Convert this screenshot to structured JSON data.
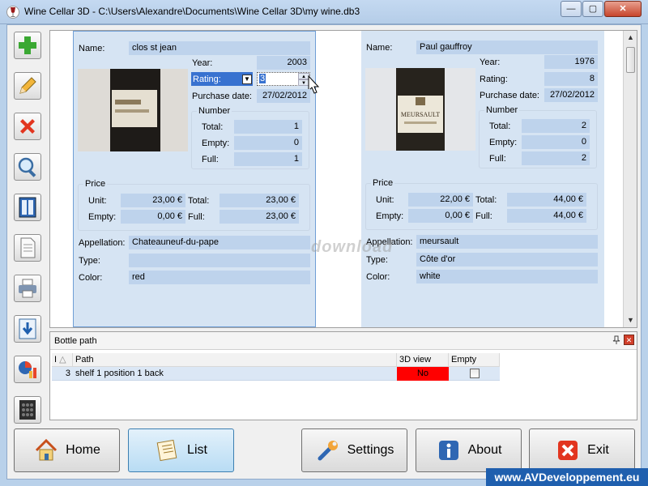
{
  "window": {
    "title": "Wine Cellar 3D - C:\\Users\\Alexandre\\Documents\\Wine Cellar 3D\\my wine.db3",
    "minimize": "—",
    "maximize": "▢",
    "close": "✕"
  },
  "toolbar": {
    "icons": [
      "add-icon",
      "edit-icon",
      "delete-icon",
      "search-icon",
      "cellar-icon",
      "document-icon",
      "print-icon",
      "export-icon",
      "statistics-icon",
      "wine-rack-icon"
    ]
  },
  "labels": {
    "name": "Name:",
    "year": "Year:",
    "rating": "Rating:",
    "purchase_date": "Purchase date:",
    "number": "Number",
    "total": "Total:",
    "empty": "Empty:",
    "full": "Full:",
    "price": "Price",
    "unit": "Unit:",
    "appellation": "Appellation:",
    "type": "Type:",
    "color": "Color:"
  },
  "wines": [
    {
      "name": "clos st jean",
      "year": "2003",
      "rating": "3",
      "purchase_date": "27/02/2012",
      "number_total": "1",
      "number_empty": "0",
      "number_full": "1",
      "price_unit": "23,00 €",
      "price_total": "23,00 €",
      "price_empty": "0,00 €",
      "price_full": "23,00 €",
      "appellation": "Chateauneuf-du-pape",
      "type": "",
      "color": "red"
    },
    {
      "name": "Paul gauffroy",
      "year": "1976",
      "rating": "8",
      "purchase_date": "27/02/2012",
      "number_total": "2",
      "number_empty": "0",
      "number_full": "2",
      "price_unit": "22,00 €",
      "price_total": "44,00 €",
      "price_empty": "0,00 €",
      "price_full": "44,00 €",
      "appellation": "meursault",
      "type": "Côte d'or",
      "color": "white",
      "label_text": "MEURSAULT"
    }
  ],
  "watermark": "download",
  "bottle_path": {
    "title": "Bottle path",
    "columns": [
      "I",
      "Path",
      "3D view",
      "Empty"
    ],
    "rows": [
      {
        "index": "3",
        "path": "shelf 1 position 1 back",
        "view3d": "No",
        "empty": false
      }
    ]
  },
  "buttons": {
    "home": "Home",
    "list": "List",
    "settings": "Settings",
    "about": "About",
    "exit": "Exit"
  },
  "footer_url": "www.AVDeveloppement.eu"
}
